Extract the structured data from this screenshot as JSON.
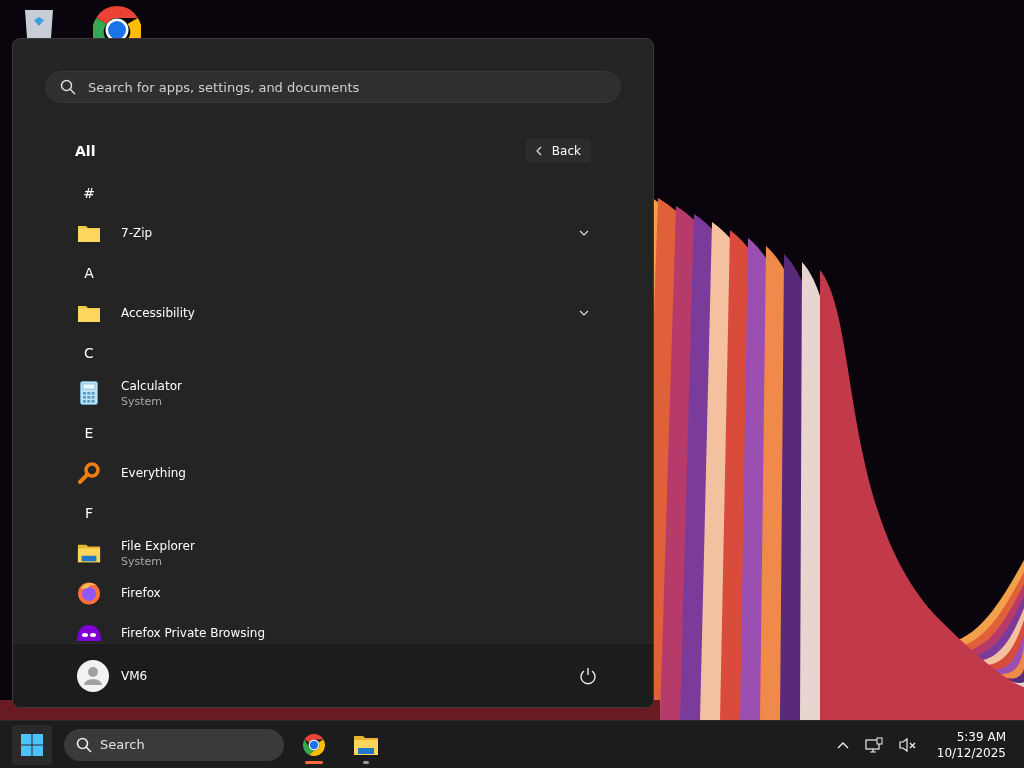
{
  "start_menu": {
    "search": {
      "placeholder": "Search for apps, settings, and documents"
    },
    "all_apps": {
      "title": "All",
      "back_button": "Back",
      "items": [
        {
          "kind": "letter",
          "label": "#"
        },
        {
          "kind": "app",
          "label": "7-Zip",
          "expandable": true
        },
        {
          "kind": "letter",
          "label": "A"
        },
        {
          "kind": "app",
          "label": "Accessibility",
          "expandable": true
        },
        {
          "kind": "letter",
          "label": "C"
        },
        {
          "kind": "app",
          "label": "Calculator",
          "subtitle": "System",
          "expandable": false
        },
        {
          "kind": "letter",
          "label": "E"
        },
        {
          "kind": "app",
          "label": "Everything",
          "expandable": false
        },
        {
          "kind": "letter",
          "label": "F"
        },
        {
          "kind": "app",
          "label": "File Explorer",
          "subtitle": "System",
          "expandable": false
        },
        {
          "kind": "app",
          "label": "Firefox",
          "expandable": false
        },
        {
          "kind": "app",
          "label": "Firefox Private Browsing",
          "expandable": false
        }
      ]
    },
    "footer": {
      "user": "VM6"
    }
  },
  "taskbar": {
    "search": {
      "placeholder": "Search"
    },
    "pinned": [
      {
        "active": true
      },
      {
        "active": false
      }
    ],
    "clock": {
      "time": "5:39 AM",
      "date": "10/12/2025"
    }
  }
}
